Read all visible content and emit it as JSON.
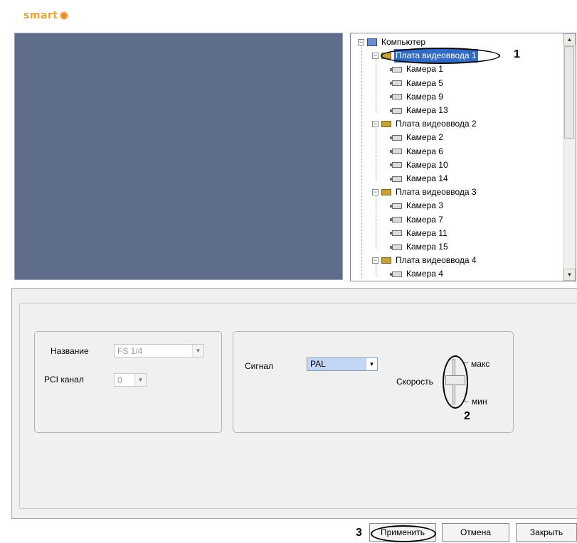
{
  "app": {
    "logo_text": "smart"
  },
  "tree": {
    "root_label": "Компьютер",
    "nodes": [
      {
        "label": "Плата видеоввода 1",
        "selected": true,
        "cameras": [
          "Камера 1",
          "Камера 5",
          "Камера 9",
          "Камера 13"
        ]
      },
      {
        "label": "Плата видеоввода 2",
        "selected": false,
        "cameras": [
          "Камера 2",
          "Камера 6",
          "Камера 10",
          "Камера 14"
        ]
      },
      {
        "label": "Плата видеоввода 3",
        "selected": false,
        "cameras": [
          "Камера 3",
          "Камера 7",
          "Камера 11",
          "Камера 15"
        ]
      },
      {
        "label": "Плата видеоввода 4",
        "selected": false,
        "cameras": [
          "Камера 4"
        ]
      }
    ]
  },
  "settings": {
    "name_label": "Название",
    "name_value": "FS 1/4",
    "pci_label": "PCI канал",
    "pci_value": "0",
    "signal_label": "Сигнал",
    "signal_value": "PAL",
    "speed_label": "Скорость",
    "speed_max_label": "макс",
    "speed_min_label": "мин"
  },
  "buttons": {
    "apply": "Применить",
    "cancel": "Отмена",
    "close": "Закрыть"
  },
  "annotations": {
    "one": "1",
    "two": "2",
    "three": "3"
  }
}
